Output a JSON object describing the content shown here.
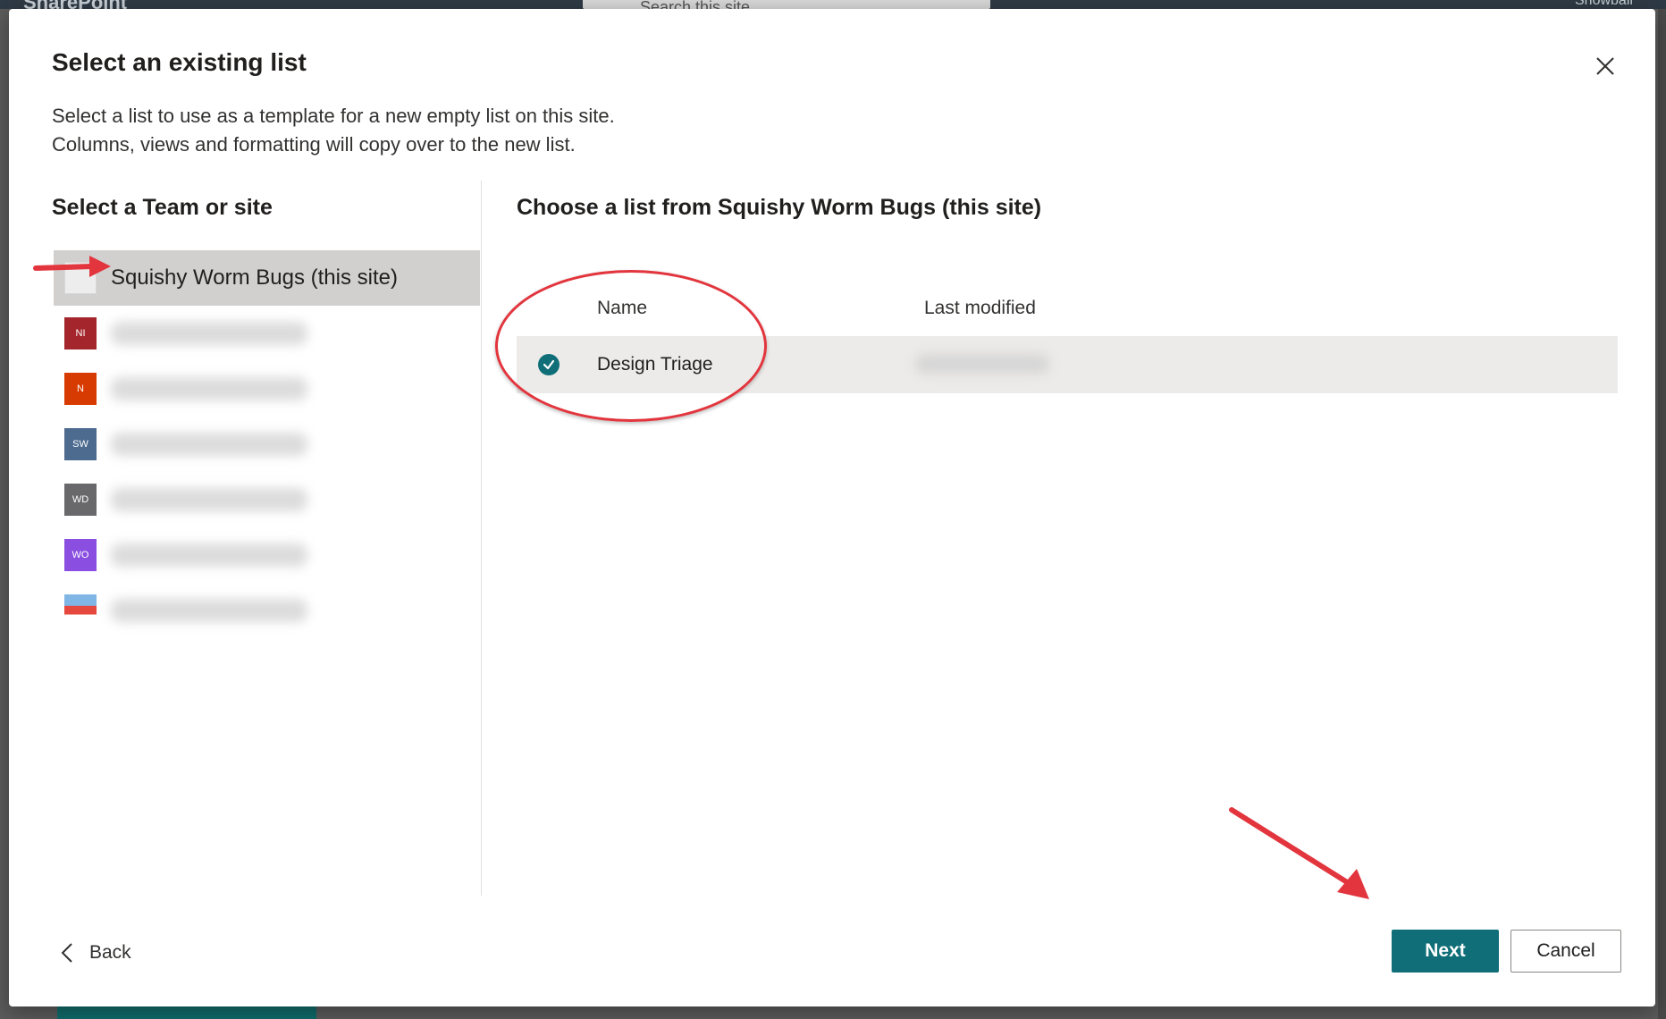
{
  "background": {
    "brand": "SharePoint",
    "search_placeholder": "Search this site",
    "user": "Snowball"
  },
  "dialog": {
    "title": "Select an existing list",
    "description_line1": "Select a list to use as a template for a new empty list on this site.",
    "description_line2": "Columns, views and formatting will copy over to the new list.",
    "close_icon": "close-icon"
  },
  "left_pane": {
    "heading": "Select a Team or site",
    "sites": [
      {
        "name": "Squishy Worm Bugs (this site)",
        "tile": "",
        "color": "#ededed",
        "selected": true
      },
      {
        "name": "",
        "tile": "NI",
        "color": "#a4262c"
      },
      {
        "name": "",
        "tile": "N",
        "color": "#d83b01"
      },
      {
        "name": "",
        "tile": "SW",
        "color": "#4f6bed"
      },
      {
        "name": "",
        "tile": "WD",
        "color": "#605e5c"
      },
      {
        "name": "",
        "tile": "WO",
        "color": "#8764b8"
      },
      {
        "name": "",
        "tile": "",
        "color": "image-thumbnail"
      }
    ]
  },
  "right_pane": {
    "heading": "Choose a list from Squishy Worm Bugs (this site)",
    "columns": {
      "name": "Name",
      "last_modified": "Last modified"
    },
    "rows": [
      {
        "name": "Design Triage",
        "last_modified": "",
        "selected": true
      }
    ]
  },
  "footer": {
    "back_label": "Back",
    "next_label": "Next",
    "cancel_label": "Cancel"
  },
  "colors": {
    "accent": "#0f6e78",
    "annotation": "#e2353d"
  }
}
